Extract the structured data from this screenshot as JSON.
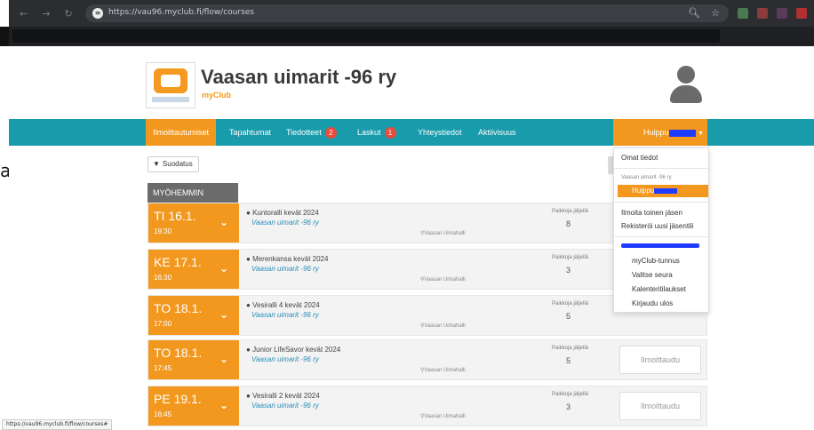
{
  "browser": {
    "url": "https://vau96.myclub.fi/flow/courses",
    "status_url": "https://vau96.myclub.fi/flow/courses#"
  },
  "stray_text": "a",
  "header": {
    "club_name": "Vaasan uimarit -96 ry",
    "subtitle": "myClub"
  },
  "nav": {
    "items": [
      {
        "label": "Ilmoittautumiset"
      },
      {
        "label": "Tapahtumat"
      },
      {
        "label": "Tiedotteet",
        "badge": "2"
      },
      {
        "label": "Laskut",
        "badge": "1"
      },
      {
        "label": "Yhteystiedot"
      },
      {
        "label": "Aktiivisuus"
      }
    ],
    "user_label": "Huippu"
  },
  "filter_label": "Suodatus",
  "section_label": "MYÖHEMMIN",
  "courses": [
    {
      "day": "TI 16.1.",
      "time": "19:30",
      "title": "Kuntoralli kevät 2024",
      "org": "Vaasan uimarit -96 ry",
      "location": "Vaasan Uimahalli",
      "spots_label": "Paikkoja jäljellä",
      "spots": "8",
      "button": ""
    },
    {
      "day": "KE 17.1.",
      "time": "16:30",
      "title": "Merenkansa kevät 2024",
      "org": "Vaasan uimarit -96 ry",
      "location": "Vaasan Uimahalli",
      "spots_label": "Paikkoja jäljellä",
      "spots": "3",
      "button": ""
    },
    {
      "day": "TO 18.1.",
      "time": "17:00",
      "title": "Vesiralli 4 kevät 2024",
      "org": "Vaasan uimarit -96 ry",
      "location": "Vaasan Uimahalli",
      "spots_label": "Paikkoja jäljellä",
      "spots": "5",
      "button": ""
    },
    {
      "day": "TO 18.1.",
      "time": "17:45",
      "title": "Junior LifeSavor kevät 2024",
      "org": "Vaasan uimarit -96 ry",
      "location": "Vaasan Uimahalli",
      "spots_label": "Paikkoja jäljellä",
      "spots": "5",
      "button": "Ilmoittaudu"
    },
    {
      "day": "PE 19.1.",
      "time": "16:45",
      "title": "Vesiralli 2 kevät 2024",
      "org": "Vaasan uimarit -96 ry",
      "location": "Vaasan Uimahalli",
      "spots_label": "Paikkoja jäljellä",
      "spots": "3",
      "button": "Ilmoittaudu"
    }
  ],
  "dropdown": {
    "own_info": "Omat tiedot",
    "club_small": "Vaasan uimarit -96 ry",
    "selected": "Huippu",
    "add_member": "Ilmoita toinen jäsen",
    "register_new": "Rekisteröi uusi jäsentili",
    "myclub_id": "myClub-tunnus",
    "choose_club": "Valitse seura",
    "calendar_orders": "Kalenteritilaukset",
    "logout": "Kirjaudu ulos"
  }
}
